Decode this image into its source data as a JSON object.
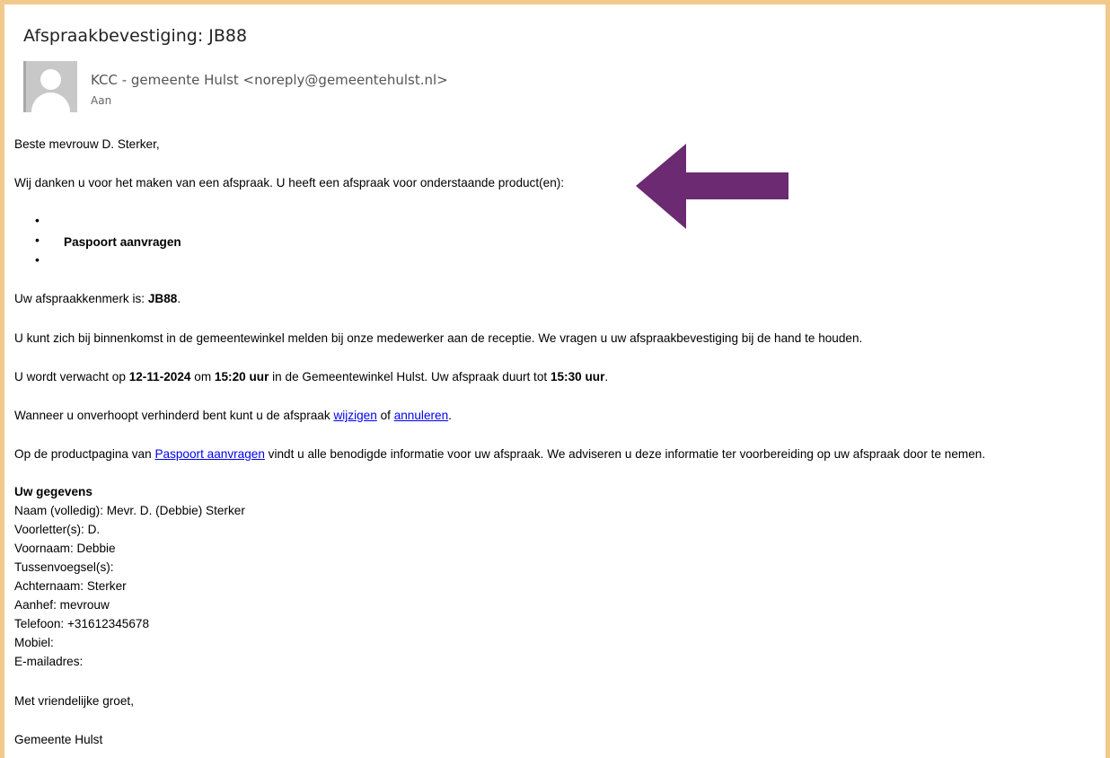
{
  "email": {
    "subject": "Afspraakbevestiging: JB88",
    "sender": "KCC - gemeente Hulst <noreply@gemeentehulst.nl>",
    "to_label": "Aan"
  },
  "body": {
    "greeting": "Beste mevrouw D. Sterker,",
    "thanks": "Wij danken u voor het maken van een afspraak. U heeft een afspraak voor onderstaande product(en):",
    "products": [
      "",
      "Paspoort aanvragen",
      ""
    ],
    "reference_prefix": "Uw afspraakkenmerk is: ",
    "reference_value": "JB88",
    "reference_suffix": ".",
    "reception": "U kunt zich bij binnenkomst in de gemeentewinkel melden bij onze medewerker aan de receptie. We vragen u uw afspraakbevestiging bij de hand te houden.",
    "expected_1": "U wordt verwacht op ",
    "expected_date": "12-11-2024",
    "expected_2": " om ",
    "expected_time": "15:20 uur",
    "expected_3": " in de Gemeentewinkel Hulst. Uw afspraak duurt tot ",
    "expected_end": "15:30 uur",
    "expected_4": ".",
    "change_1": "Wanneer u onverhoopt verhinderd bent kunt u de afspraak ",
    "change_link": "wijzigen",
    "change_2": " of ",
    "cancel_link": "annuleren",
    "change_3": ".",
    "product_1": "Op de productpagina van ",
    "product_link": "Paspoort aanvragen",
    "product_2": " vindt u alle benodigde informatie voor uw afspraak. We adviseren u deze informatie ter voorbereiding op uw afspraak door te nemen.",
    "details_heading": "Uw gegevens",
    "details": [
      "Naam (volledig): Mevr. D. (Debbie) Sterker",
      "Voorletter(s): D.",
      "Voornaam: Debbie",
      "Tussenvoegsel(s):",
      "Achternaam: Sterker",
      "Aanhef: mevrouw",
      "Telefoon: +31612345678",
      "Mobiel:",
      "E-mailadres:"
    ],
    "closing": "Met vriendelijke groet,",
    "signature": "Gemeente Hulst"
  },
  "colors": {
    "frame": "#f2c98d",
    "arrow": "#6b2a72",
    "link": "#0000ee"
  },
  "icons": {
    "avatar": "person-silhouette-icon",
    "arrow": "left-arrow-icon"
  }
}
